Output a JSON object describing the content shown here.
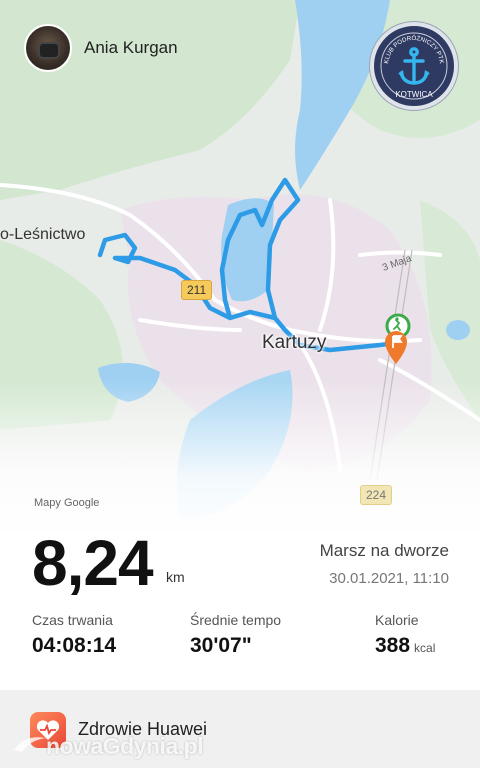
{
  "user": {
    "name": "Ania Kurgan"
  },
  "club_badge": {
    "text": "KLUB PODRÓŻNICZY PTK",
    "name": "KOTWICA",
    "icon": "anchor-icon"
  },
  "map": {
    "labels": {
      "lesnictwo": "o-Leśnictwo",
      "kartuzy": "Kartuzy",
      "street": "3 Maja"
    },
    "roads": [
      "211",
      "224"
    ],
    "source": "Mapy Google",
    "route_color": "#2e9be6",
    "start_marker_color": "#3daa4a",
    "end_marker_color": "#f07a2b"
  },
  "activity": {
    "distance": "8,24",
    "distance_unit": "km",
    "type": "Marsz na dworze",
    "datetime": "30.01.2021, 11:10"
  },
  "stats": [
    {
      "label": "Czas trwania",
      "value": "04:08:14",
      "unit": ""
    },
    {
      "label": "Średnie tempo",
      "value": "30'07\"",
      "unit": ""
    },
    {
      "label": "Kalorie",
      "value": "388",
      "unit": "kcal"
    }
  ],
  "footer": {
    "app_name": "Zdrowie Huawei",
    "watermark": "nowaGdynia.pl"
  }
}
